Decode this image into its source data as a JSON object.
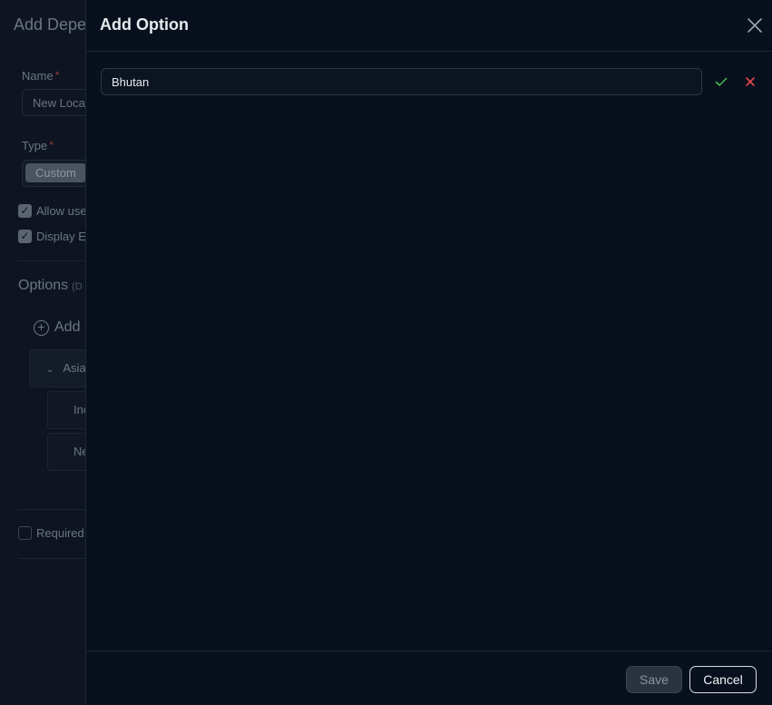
{
  "background": {
    "title": "Add Depe",
    "name_label": "Name",
    "required_mark": "*",
    "name_value": "New Loca",
    "type_label": "Type",
    "type_value": "Custom",
    "checkbox_allow": "Allow use",
    "checkbox_display": "Display E",
    "options_heading": "Options",
    "options_sub": "(D",
    "add_label": "Add",
    "tree_group": "Asia",
    "tree_items": [
      "Inc",
      "Ne"
    ],
    "required_checkbox": "Required"
  },
  "drawer": {
    "title": "Add Option",
    "close_icon": "close-icon",
    "input_value": "Bhutan",
    "confirm_icon": "check-icon",
    "confirm_color": "#3fb950",
    "cancel_icon": "x-icon",
    "cancel_color": "#e5484d",
    "save_label": "Save",
    "cancel_label": "Cancel"
  }
}
